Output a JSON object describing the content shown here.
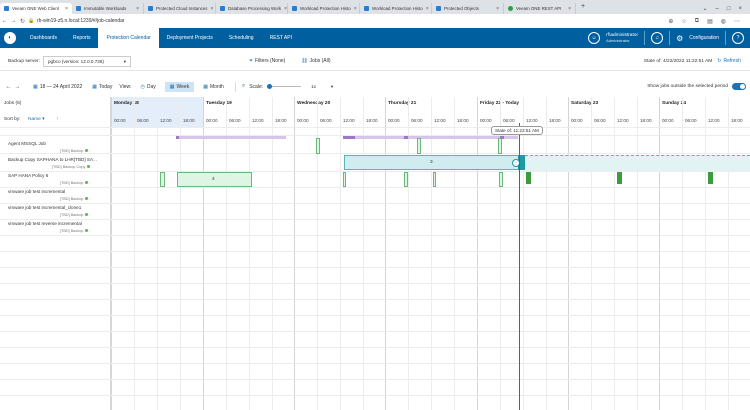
{
  "browser": {
    "tabs": [
      {
        "label": "Veeam ONE Web Client",
        "active": true,
        "icon": "veeam-icon"
      },
      {
        "label": "Immutable Workloads",
        "active": false,
        "icon": "veeam-icon"
      },
      {
        "label": "Protected Cloud Instances",
        "active": false,
        "icon": "veeam-icon"
      },
      {
        "label": "Database Processing Work",
        "active": false,
        "icon": "veeam-icon"
      },
      {
        "label": "Workload Protection Histo",
        "active": false,
        "icon": "veeam-icon"
      },
      {
        "label": "Workload Protection Histo",
        "active": false,
        "icon": "veeam-icon"
      },
      {
        "label": "Protected Objects",
        "active": false,
        "icon": "veeam-icon"
      },
      {
        "label": "Veeam ONE REST API",
        "active": false,
        "icon": "green-dot-icon"
      }
    ],
    "new_tab": "+",
    "url": "rb-win19-z5.n.local:1239/#/job-calendar"
  },
  "app": {
    "nav": [
      "Dashboards",
      "Reports",
      "Protection Calendar",
      "Deployment Projects",
      "Scheduling",
      "REST API"
    ],
    "active_nav": "Protection Calendar",
    "user": {
      "name": "rf\\administrator",
      "role": "Administrator"
    },
    "configuration": "Configuration",
    "help": "?"
  },
  "toolbar1": {
    "backup_server_label": "Backup server:",
    "backup_server_value": "pgbco (version: 12.0.0.736)",
    "filters": "Filters (None)",
    "jobs": "Jobs (All)",
    "state": "State of: 4/22/2022 11:22:51 AM",
    "refresh": "Refresh"
  },
  "toolbar2": {
    "date_range": "18 — 24 April 2022",
    "today": "Today",
    "view_label": "View:",
    "views": [
      "Day",
      "Week",
      "Month"
    ],
    "active_view": "Week",
    "scale_label": "Scale:",
    "scale_value": "1x",
    "show_jobs_label": "Show jobs outside the selected period",
    "show_jobs_on": true
  },
  "calendar": {
    "jobs_header": "Jobs (6)",
    "sort_label": "Sort by:",
    "sort_value": "Name",
    "days": [
      "Monday 18",
      "Tuesday 19",
      "Wednesday 20",
      "Thursday 21",
      "Friday 22 - Today",
      "Saturday 23",
      "Sunday 24"
    ],
    "hours": [
      "00:00",
      "06:00",
      "12:00",
      "18:00"
    ],
    "now_tooltip": "State of: 11:22:51 AM",
    "jobs": [
      {
        "name": "Agent MSSQL Job",
        "type": "[TBD] Backup"
      },
      {
        "name": "Backup Copy SAPHANA to LHR[TBD] SA...",
        "type": "[TBD] Backup Copy"
      },
      {
        "name": "SAP HANA Policy 6",
        "type": "[TBD] Backup"
      },
      {
        "name": "vmware job test incremental",
        "type": "[TBD] Backup"
      },
      {
        "name": "vmware job test incremental_clone1",
        "type": "[TBD] Backup"
      },
      {
        "name": "vmware job test reverse incremental",
        "type": "[TBD] Backup"
      }
    ],
    "bar_labels": {
      "sap_tuesday": "4",
      "backup_copy": "3"
    }
  },
  "colors": {
    "header_blue": "#005f9e",
    "accent_blue": "#1a73b8",
    "success_green": "#3c9b3f",
    "copy_teal": "#5bb2b8"
  }
}
